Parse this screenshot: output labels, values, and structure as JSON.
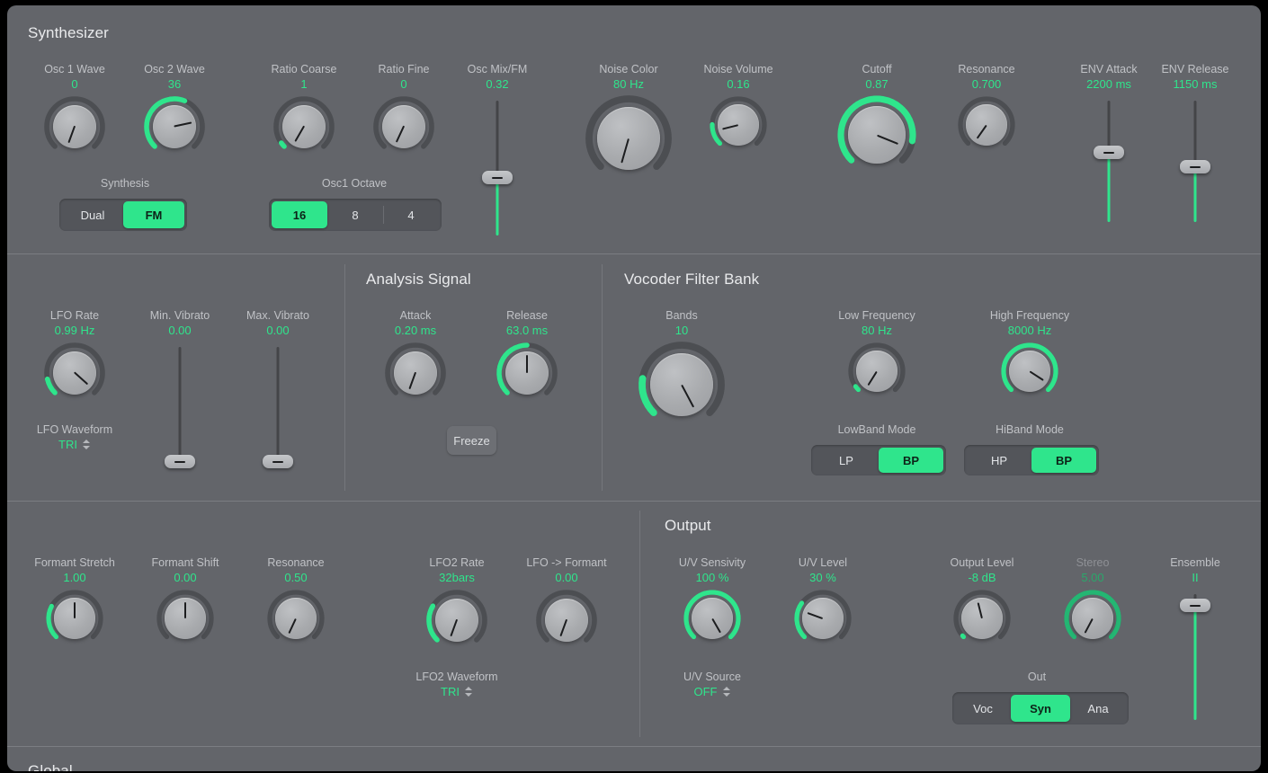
{
  "accent": "#2fe58c",
  "background": "#63656a",
  "sections": {
    "synthesizer": "Synthesizer",
    "analysis_signal": "Analysis Signal",
    "vocoder_filter_bank": "Vocoder Filter Bank",
    "output": "Output",
    "global": "Global"
  },
  "synth": {
    "osc1_wave": {
      "label": "Osc 1 Wave",
      "value": "0"
    },
    "osc2_wave": {
      "label": "Osc 2 Wave",
      "value": "36"
    },
    "ratio_coarse": {
      "label": "Ratio Coarse",
      "value": "1"
    },
    "ratio_fine": {
      "label": "Ratio Fine",
      "value": "0"
    },
    "osc_mix_fm": {
      "label": "Osc Mix/FM",
      "value": "0.32"
    },
    "noise_color": {
      "label": "Noise Color",
      "value": "80 Hz"
    },
    "noise_volume": {
      "label": "Noise Volume",
      "value": "0.16"
    },
    "cutoff": {
      "label": "Cutoff",
      "value": "0.87"
    },
    "resonance": {
      "label": "Resonance",
      "value": "0.700"
    },
    "env_attack": {
      "label": "ENV Attack",
      "value": "2200 ms"
    },
    "env_release": {
      "label": "ENV Release",
      "value": "1150 ms"
    },
    "synthesis": {
      "label": "Synthesis",
      "options": [
        "Dual",
        "FM"
      ],
      "selected": "FM"
    },
    "osc1_octave": {
      "label": "Osc1 Octave",
      "options": [
        "16",
        "8",
        "4"
      ],
      "selected": "16"
    }
  },
  "lfo": {
    "lfo_rate": {
      "label": "LFO Rate",
      "value": "0.99 Hz"
    },
    "min_vibrato": {
      "label": "Min. Vibrato",
      "value": "0.00"
    },
    "max_vibrato": {
      "label": "Max. Vibrato",
      "value": "0.00"
    },
    "lfo_waveform": {
      "label": "LFO Waveform",
      "value": "TRI"
    }
  },
  "analysis": {
    "attack": {
      "label": "Attack",
      "value": "0.20 ms"
    },
    "release": {
      "label": "Release",
      "value": "63.0 ms"
    },
    "freeze": {
      "label": "Freeze"
    }
  },
  "vocoder": {
    "bands": {
      "label": "Bands",
      "value": "10"
    },
    "low_frequency": {
      "label": "Low Frequency",
      "value": "80 Hz"
    },
    "high_frequency": {
      "label": "High Frequency",
      "value": "8000 Hz"
    },
    "lowband_mode": {
      "label": "LowBand Mode",
      "options": [
        "LP",
        "BP"
      ],
      "selected": "BP"
    },
    "hiband_mode": {
      "label": "HiBand Mode",
      "options": [
        "HP",
        "BP"
      ],
      "selected": "BP"
    }
  },
  "formant": {
    "formant_stretch": {
      "label": "Formant Stretch",
      "value": "1.00"
    },
    "formant_shift": {
      "label": "Formant Shift",
      "value": "0.00"
    },
    "resonance": {
      "label": "Resonance",
      "value": "0.50"
    },
    "lfo2_rate": {
      "label": "LFO2 Rate",
      "value": "32bars"
    },
    "lfo_to_formant": {
      "label": "LFO -> Formant",
      "value": "0.00"
    },
    "lfo2_waveform": {
      "label": "LFO2 Waveform",
      "value": "TRI"
    }
  },
  "out": {
    "uv_sensivity": {
      "label": "U/V Sensivity",
      "value": "100 %"
    },
    "uv_level": {
      "label": "U/V Level",
      "value": "30 %"
    },
    "uv_source": {
      "label": "U/V Source",
      "value": "OFF"
    },
    "output_level": {
      "label": "Output Level",
      "value": "-8 dB"
    },
    "stereo": {
      "label": "Stereo",
      "value": "5.00"
    },
    "ensemble": {
      "label": "Ensemble",
      "value": "II"
    },
    "out_routing": {
      "label": "Out",
      "options": [
        "Voc",
        "Syn",
        "Ana"
      ],
      "selected": "Syn"
    }
  }
}
